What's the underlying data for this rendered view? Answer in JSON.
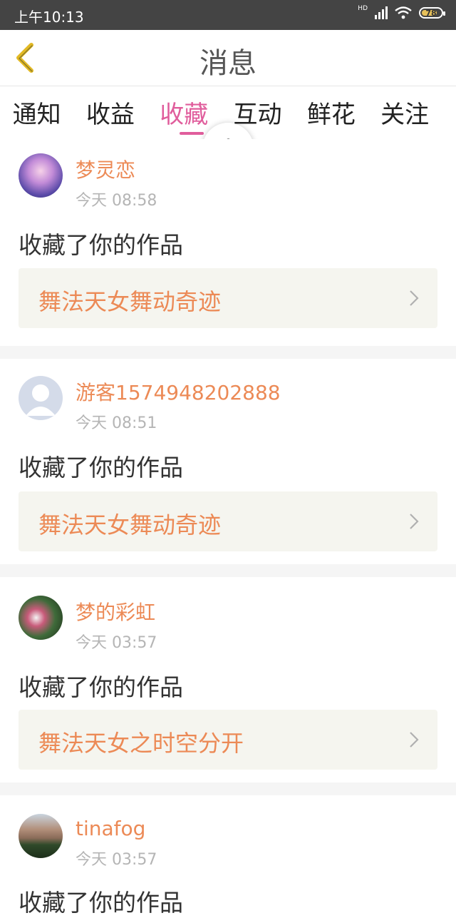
{
  "status_bar": {
    "time": "上午10:13",
    "network": "HD",
    "battery": "78"
  },
  "header": {
    "title": "消息"
  },
  "tabs": [
    {
      "label": "通知"
    },
    {
      "label": "收益"
    },
    {
      "label": "收藏",
      "active": true
    },
    {
      "label": "互动"
    },
    {
      "label": "鲜花"
    },
    {
      "label": "关注"
    }
  ],
  "feed": [
    {
      "user": "梦灵恋",
      "time": "今天 08:58",
      "action": "收藏了你的作品",
      "work": "舞法天女舞动奇迹"
    },
    {
      "user": "游客1574948202888",
      "time": "今天 08:51",
      "action": "收藏了你的作品",
      "work": "舞法天女舞动奇迹"
    },
    {
      "user": "梦的彩虹",
      "time": "今天 03:57",
      "action": "收藏了你的作品",
      "work": "舞法天女之时空分开"
    },
    {
      "user": "tinafog",
      "time": "今天 03:57",
      "action": "收藏了你的作品"
    }
  ],
  "colors": {
    "accent": "#e05d9c",
    "username": "#ec8a56",
    "status_bar": "#444444"
  }
}
